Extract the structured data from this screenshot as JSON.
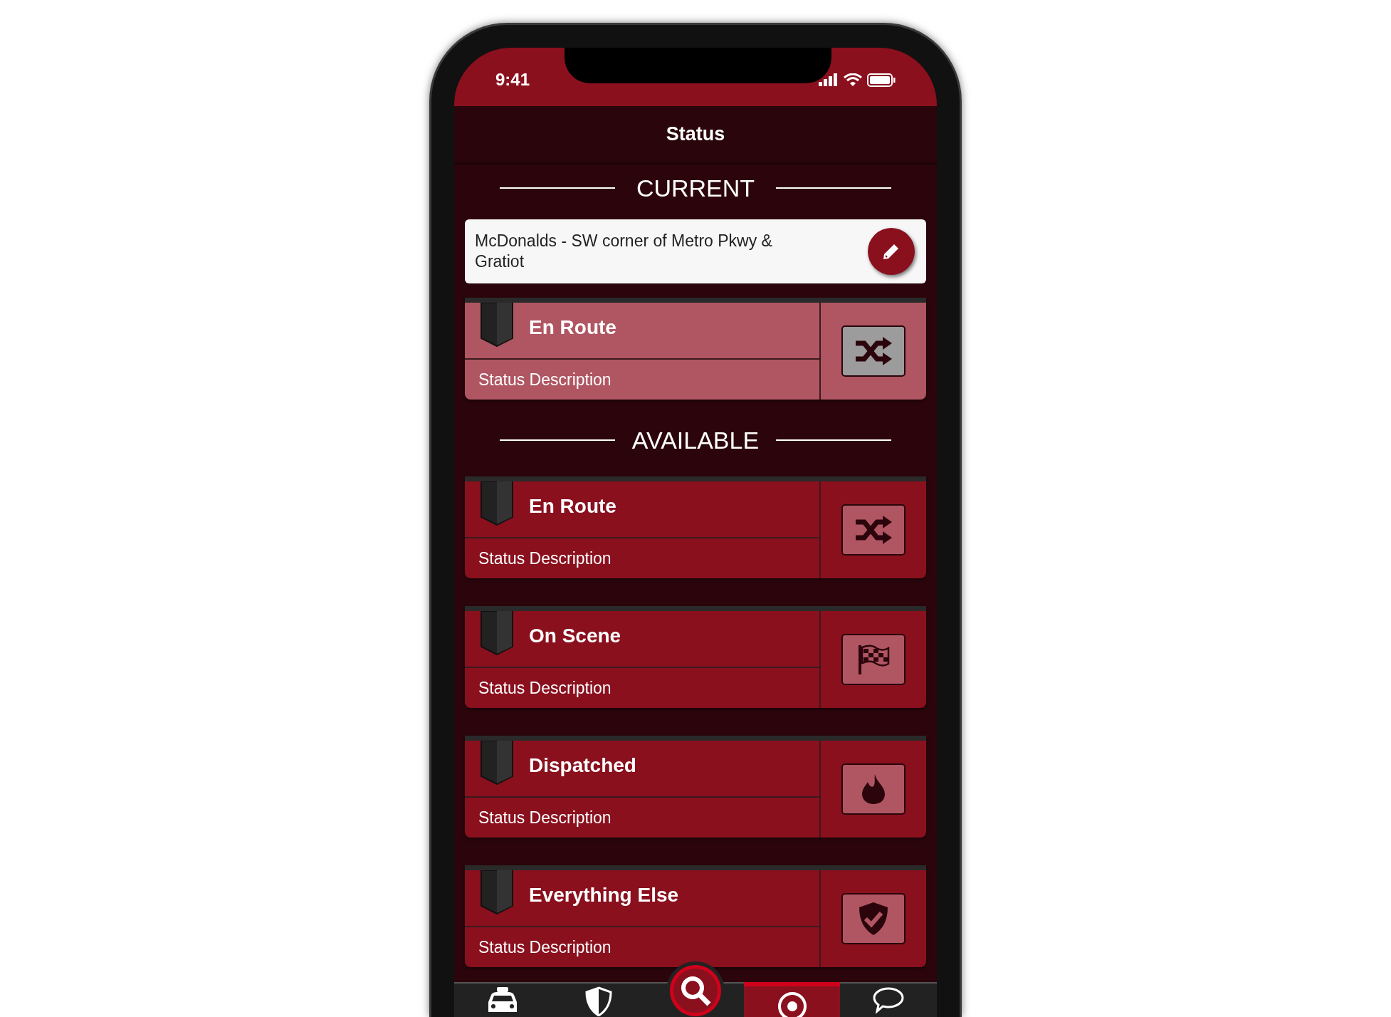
{
  "status_bar": {
    "time": "9:41"
  },
  "header": {
    "title": "Status"
  },
  "current": {
    "heading": "CURRENT",
    "location": "McDonalds - SW corner of Metro Pkwy & Gratiot",
    "status": {
      "title": "En Route",
      "description": "Status Description",
      "kind": "shuffle"
    }
  },
  "available": {
    "heading": "AVAILABLE",
    "statuses": [
      {
        "title": "En Route",
        "description": "Status Description",
        "kind": "shuffle"
      },
      {
        "title": "On Scene",
        "description": "Status Description",
        "kind": "flag"
      },
      {
        "title": "Dispatched",
        "description": "Status Description",
        "kind": "fire"
      },
      {
        "title": "Everything Else",
        "description": "Status Description",
        "kind": "shield-check"
      }
    ]
  },
  "tab_bar": [
    {
      "kind": "taxi",
      "selected": false
    },
    {
      "kind": "shield",
      "selected": false
    },
    {
      "kind": "search",
      "selected": false
    },
    {
      "kind": "target",
      "selected": true
    },
    {
      "kind": "chat",
      "selected": false
    }
  ]
}
